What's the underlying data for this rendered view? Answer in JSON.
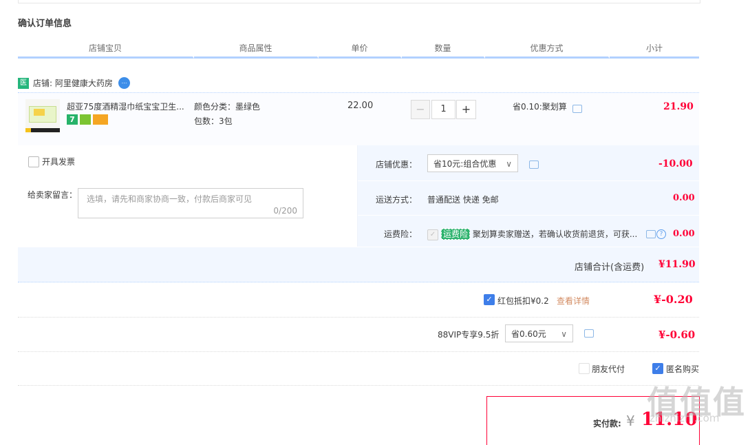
{
  "title": "确认订单信息",
  "columns": [
    "店铺宝贝",
    "商品属性",
    "单价",
    "数量",
    "优惠方式",
    "小计"
  ],
  "shop": {
    "badge": "医",
    "name": "店铺: 阿里健康大药房"
  },
  "item": {
    "name": "超亚75度酒精湿巾纸宝宝卫生...",
    "badge7": "7",
    "attr_color": "颜色分类：墨绿色",
    "attr_pack": "包数：3包",
    "unit_price": "22.00",
    "qty_minus": "−",
    "quantity": "1",
    "qty_plus": "+",
    "discount": "省0.10:聚划算",
    "subtotal": "21.90"
  },
  "invoice_label": "开具发票",
  "memo": {
    "label": "给卖家留言：",
    "placeholder": "选填，请先和商家协商一致，付款后商家可见",
    "counter": "0/200"
  },
  "shop_discount": {
    "label": "店铺优惠：",
    "selected": "省10元:组合优惠",
    "amount": "-10.00"
  },
  "shipping": {
    "label": "运送方式：",
    "value": "普通配送 快递 免邮",
    "amount": "0.00"
  },
  "insurance": {
    "label": "运费险：",
    "tag": "运费险",
    "text": "聚划算卖家赠送，若确认收货前退货，可获...",
    "amount": "0.00"
  },
  "shop_total": {
    "label": "店铺合计(含运费)",
    "amount": "¥11.90"
  },
  "red_packet": {
    "label": "红包抵扣¥0.2",
    "link": "查看详情",
    "amount": "¥-0.20"
  },
  "vip": {
    "label": "88VIP专享9.5折",
    "selected": "省0.60元",
    "amount": "¥-0.60"
  },
  "friend_pay": "朋友代付",
  "anonymous": "匿名购买",
  "pay": {
    "label": "实付款:",
    "currency": "¥",
    "amount": "11.10"
  },
  "watermark": {
    "text": "值值值",
    "url": "zhizhizhi.com"
  },
  "icons": {
    "chevron": "∨",
    "check": "✓",
    "question": "?"
  }
}
